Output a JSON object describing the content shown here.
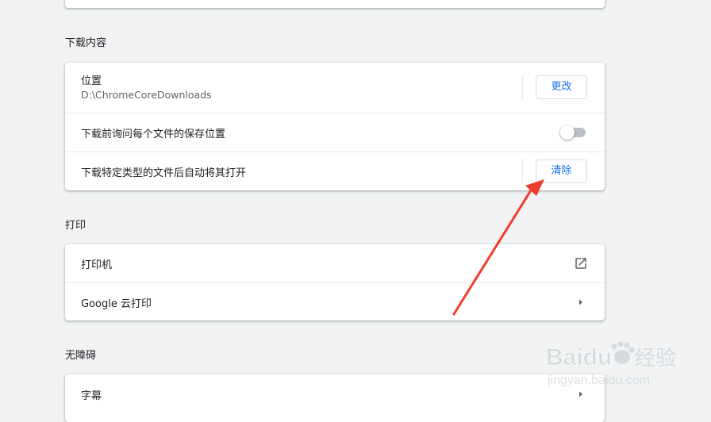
{
  "downloads": {
    "section_title": "下载内容",
    "location_label": "位置",
    "location_value": "D:\\ChromeCoreDownloads",
    "change_button": "更改",
    "ask_where_label": "下载前询问每个文件的保存位置",
    "ask_where_enabled": false,
    "auto_open_label": "下载特定类型的文件后自动将其打开",
    "clear_button": "清除"
  },
  "print": {
    "section_title": "打印",
    "printers_label": "打印机",
    "cloud_print_label": "Google 云打印"
  },
  "accessibility": {
    "section_title": "无障碍",
    "captions_label": "字幕"
  },
  "watermark": {
    "brand": "Baidu",
    "brand_cn": "经验",
    "url": "jingyan.baidu.com"
  },
  "colors": {
    "accent": "#1a73e8",
    "annotation_arrow": "#f03c2e",
    "page_background": "#f1f3f4"
  },
  "icons": {
    "external_link": "open-in-new-icon",
    "submenu": "arrow-right-icon"
  }
}
